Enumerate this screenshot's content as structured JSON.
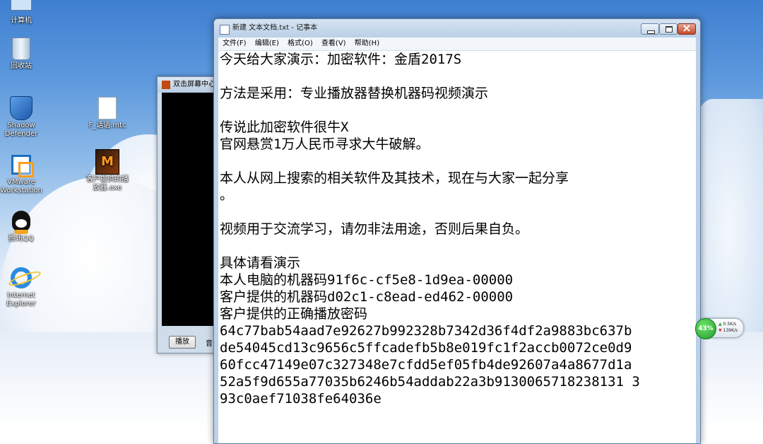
{
  "desktop": {
    "icons": [
      {
        "label": "计算机",
        "icon": "computer-icon"
      },
      {
        "label": "回收站",
        "icon": "recycle-bin-icon"
      },
      {
        "label": "Shadow Defender",
        "icon": "shield-icon"
      },
      {
        "label": "F_话语.mtc",
        "icon": "file-icon"
      },
      {
        "label": "VMware Workstation",
        "icon": "vmware-icon"
      },
      {
        "label": "客户提供的播放器.exe",
        "icon": "player-icon"
      },
      {
        "label": "腾讯QQ",
        "icon": "qq-icon"
      },
      {
        "label": "Internet Explorer",
        "icon": "ie-icon"
      }
    ]
  },
  "player_window": {
    "title": "双击屏幕中心",
    "play_button": "播放",
    "audio_label": "音"
  },
  "notepad": {
    "title": "新建 文本文档.txt - 记事本",
    "menu": [
      "文件(F)",
      "编辑(E)",
      "格式(O)",
      "查看(V)",
      "帮助(H)"
    ],
    "content": "今天给大家演示：加密软件：金盾2017S\n\n方法是采用：专业播放器替换机器码视频演示\n\n传说此加密软件很牛X\n官网悬赏1万人民币寻求大牛破解。\n\n本人从网上搜索的相关软件及其技术，现在与大家一起分享\n。\n\n视频用于交流学习，请勿非法用途，否则后果自负。\n\n具体请看演示\n本人电脑的机器码91f6c-cf5e8-1d9ea-00000\n客户提供的机器码d02c1-c8ead-ed462-00000\n客户提供的正确播放密码\n64c77bab54aad7e92627b992328b7342d36f4df2a9883bc637b\nde54045cd13c9656c5ffcadefb5b8e019fc1f2accb0072ce0d9\n60fcc47149e07c327348e7cfdd5ef05fb4de92607a4a8677d1a\n52a5f9d655a77035b6246b54addab22a3b9130065718238131 3\n93c0aef71038fe64036e"
  },
  "network_gadget": {
    "percent": "43%",
    "upload": "0.5K/s",
    "download": "139K/s"
  }
}
